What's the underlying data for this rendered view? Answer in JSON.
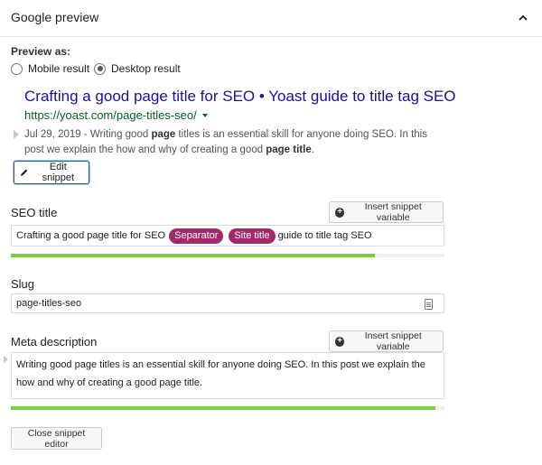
{
  "header": {
    "title": "Google preview"
  },
  "preview": {
    "label": "Preview as:",
    "options": [
      "Mobile result",
      "Desktop result"
    ],
    "selected": "Desktop result"
  },
  "snippet": {
    "title": "Crafting a good page title for SEO • Yoast guide to title tag SEO",
    "url": "https://yoast.com/page-titles-seo/",
    "desc_date": "Jul 29, 2019 - ",
    "desc_parts": [
      "Writing good ",
      "page",
      " titles is an essential skill for anyone doing SEO. In this post we explain the how and why of creating a good ",
      "page title",
      "."
    ]
  },
  "edit_snippet_label": "Edit snippet",
  "seo_title": {
    "label": "SEO title",
    "insert_label": "Insert snippet variable",
    "prefix": "Crafting a good page title for SEO",
    "pill_separator": "Separator",
    "pill_site_title": "Site title",
    "suffix": "guide to title tag SEO",
    "progress": 0.84
  },
  "slug": {
    "label": "Slug",
    "value": "page-titles-seo"
  },
  "meta": {
    "label": "Meta description",
    "insert_label": "Insert snippet variable",
    "value": "Writing good page titles is an essential skill for anyone doing SEO. In this post we explain the how and why of creating a good page title.",
    "progress": 0.98
  },
  "close_label": "Close snippet editor",
  "colors": {
    "link": "#1a0dab",
    "url": "#006621",
    "pill": "#a4286a",
    "progress": "#7ad03a"
  }
}
